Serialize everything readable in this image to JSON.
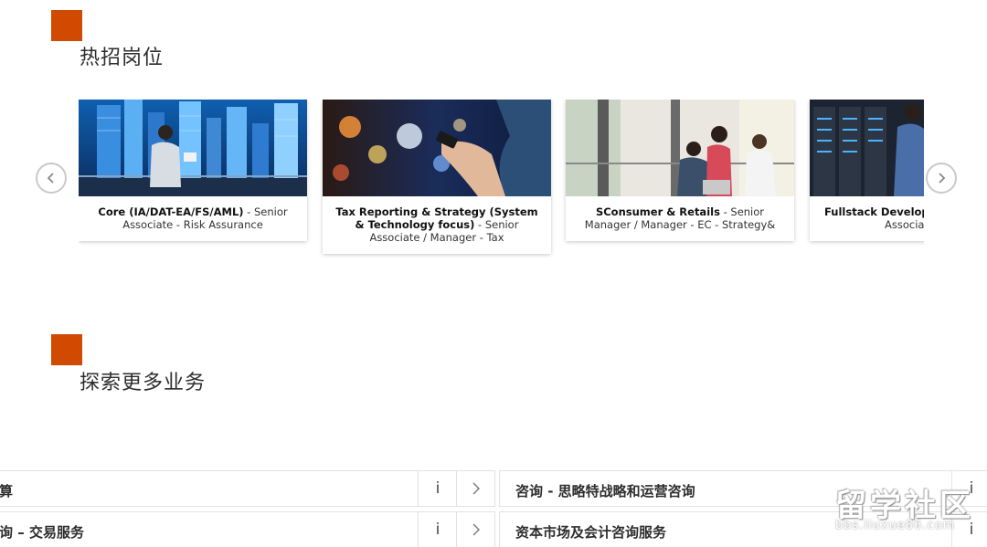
{
  "sections": {
    "hot_jobs": {
      "title": "热招岗位"
    },
    "explore": {
      "title": "探索更多业务"
    }
  },
  "carousel": {
    "cards": [
      {
        "bold": "Core (IA/DAT-EA/FS/AML)",
        "rest": " - Senior Associate - Risk Assurance"
      },
      {
        "bold": "Tax Reporting & Strategy (System & Technology focus)",
        "rest": " - Senior Associate / Manager - Tax"
      },
      {
        "bold": "SConsumer & Retails",
        "rest": " - Senior Manager / Manager - EC - Strategy&"
      },
      {
        "bold": "Fullstack Develope",
        "rest": "Associat"
      }
    ],
    "prev_icon": "chevron-left-icon",
    "next_icon": "chevron-right-icon"
  },
  "business": {
    "rows": [
      {
        "label": "算",
        "info": "i"
      },
      {
        "label": "咨询 - 思略特战略和运营咨询",
        "info": "i"
      },
      {
        "label": "询 – 交易服务",
        "info": "i"
      },
      {
        "label": "资本市场及会计咨询服务",
        "info": "i"
      }
    ]
  },
  "watermark": {
    "main": "留学社区",
    "url": "bbs.liuxue86.com"
  },
  "colors": {
    "accent": "#d04a02",
    "border": "#e2e2e2",
    "text": "#2d2d2d"
  }
}
